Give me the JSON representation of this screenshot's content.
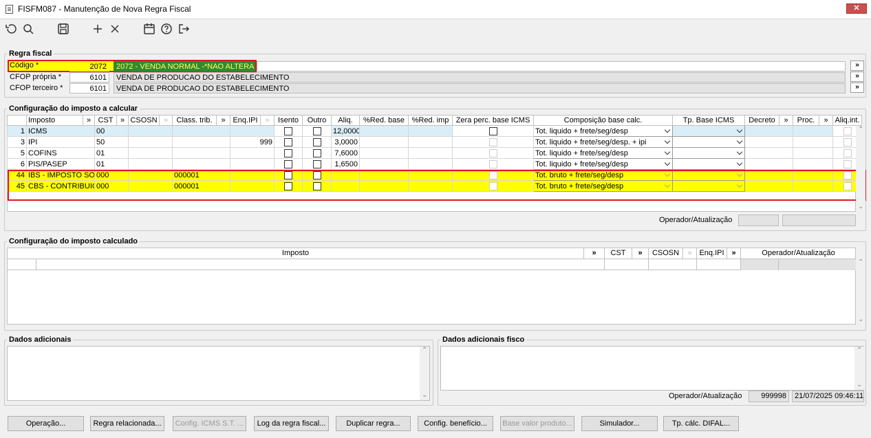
{
  "window": {
    "title": "FISFM087 - Manutenção de Nova Regra Fiscal",
    "close": "✕"
  },
  "toolbar": {
    "icons": [
      "undo-icon",
      "search-icon",
      "save-icon",
      "add-icon",
      "close-icon",
      "calendar-icon",
      "help-icon",
      "exit-icon"
    ]
  },
  "regra": {
    "group": "Regra fiscal",
    "codigo_label": "Código *",
    "codigo_value": "2072",
    "codigo_desc": "2072 - VENDA NORMAL -*NAO ALTERAR*",
    "cfop_propria_label": "CFOP própria *",
    "cfop_propria_value": "6101",
    "cfop_propria_desc": "VENDA DE PRODUCAO DO ESTABELECIMENTO",
    "cfop_terceiro_label": "CFOP terceiro *",
    "cfop_terceiro_value": "6101",
    "cfop_terceiro_desc": "VENDA DE PRODUCAO DO ESTABELECIMENTO",
    "search_btn": "»"
  },
  "config_calc": {
    "group": "Configuração do imposto a calcular",
    "headers": [
      "Imposto",
      "»",
      "CST",
      "»",
      "CSOSN",
      "",
      "Class. trib.",
      "»",
      "Enq.IPI",
      "",
      "Isento",
      "Outro",
      "Aliq.",
      "%Red. base",
      "%Red. imp",
      "Zera perc. base ICMS",
      "Composição base calc.",
      "Tp. Base ICMS",
      "Decreto",
      "»",
      "Proc.",
      "»",
      "Aliq.int."
    ],
    "rows": [
      {
        "code": "1",
        "name": "ICMS",
        "cst": "00",
        "class": "",
        "enq": "",
        "aliq": "12,0000",
        "comp": "Tot. liquido + frete/seg/desp",
        "hl": "blue"
      },
      {
        "code": "3",
        "name": "IPI",
        "cst": "50",
        "class": "",
        "enq": "999",
        "aliq": "3,0000",
        "comp": "Tot. liquido + frete/seg/desp. + ipi",
        "hl": ""
      },
      {
        "code": "5",
        "name": "COFINS",
        "cst": "01",
        "class": "",
        "enq": "",
        "aliq": "7,6000",
        "comp": "Tot. liquido + frete/seg/desp",
        "hl": ""
      },
      {
        "code": "6",
        "name": "PIS/PASEP",
        "cst": "01",
        "class": "",
        "enq": "",
        "aliq": "1,6500",
        "comp": "Tot. liquido + frete/seg/desp",
        "hl": ""
      },
      {
        "code": "44",
        "name": "IBS - IMPOSTO SOBRE BENS E SERVIÇOS",
        "cst": "000",
        "class": "000001",
        "enq": "",
        "aliq": "",
        "comp": "Tot. bruto + frete/seg/desp",
        "hl": "yellow"
      },
      {
        "code": "45",
        "name": "CBS - CONTRIBUIÇÃO SOBRE BENS E SERVIÇOS",
        "cst": "000",
        "class": "000001",
        "enq": "",
        "aliq": "",
        "comp": "Tot. bruto + frete/seg/desp",
        "hl": "yellow"
      }
    ],
    "operador_label": "Operador/Atualização"
  },
  "config_calculado": {
    "group": "Configuração do imposto calculado",
    "headers": [
      "Imposto",
      "»",
      "CST",
      "»",
      "CSOSN",
      "",
      "Enq.IPI",
      "»",
      "Operador/Atualização"
    ]
  },
  "dados": {
    "label": "Dados adicionais"
  },
  "dados_fisco": {
    "label": "Dados adicionais fisco",
    "operador_label": "Operador/Atualização",
    "operador_value": "999998",
    "data_value": "21/07/2025 09:46:11"
  },
  "buttons": [
    {
      "label": "Operação...",
      "enabled": true
    },
    {
      "label": "Regra relacionada...",
      "enabled": true
    },
    {
      "label": "Config. ICMS S.T. ...",
      "enabled": false
    },
    {
      "label": "Log da regra fiscal...",
      "enabled": true
    },
    {
      "label": "Duplicar regra...",
      "enabled": true
    },
    {
      "label": "Config. benefício...",
      "enabled": true
    },
    {
      "label": "Base valor produto...",
      "enabled": false
    },
    {
      "label": "Simulador...",
      "enabled": true
    },
    {
      "label": "Tp. cálc. DIFAL...",
      "enabled": true
    }
  ],
  "colors": {
    "highlight_yellow": "#ffff00",
    "highlight_green": "#2e8b2e",
    "border_red": "#e0161f",
    "row_blue": "#daeef8"
  }
}
